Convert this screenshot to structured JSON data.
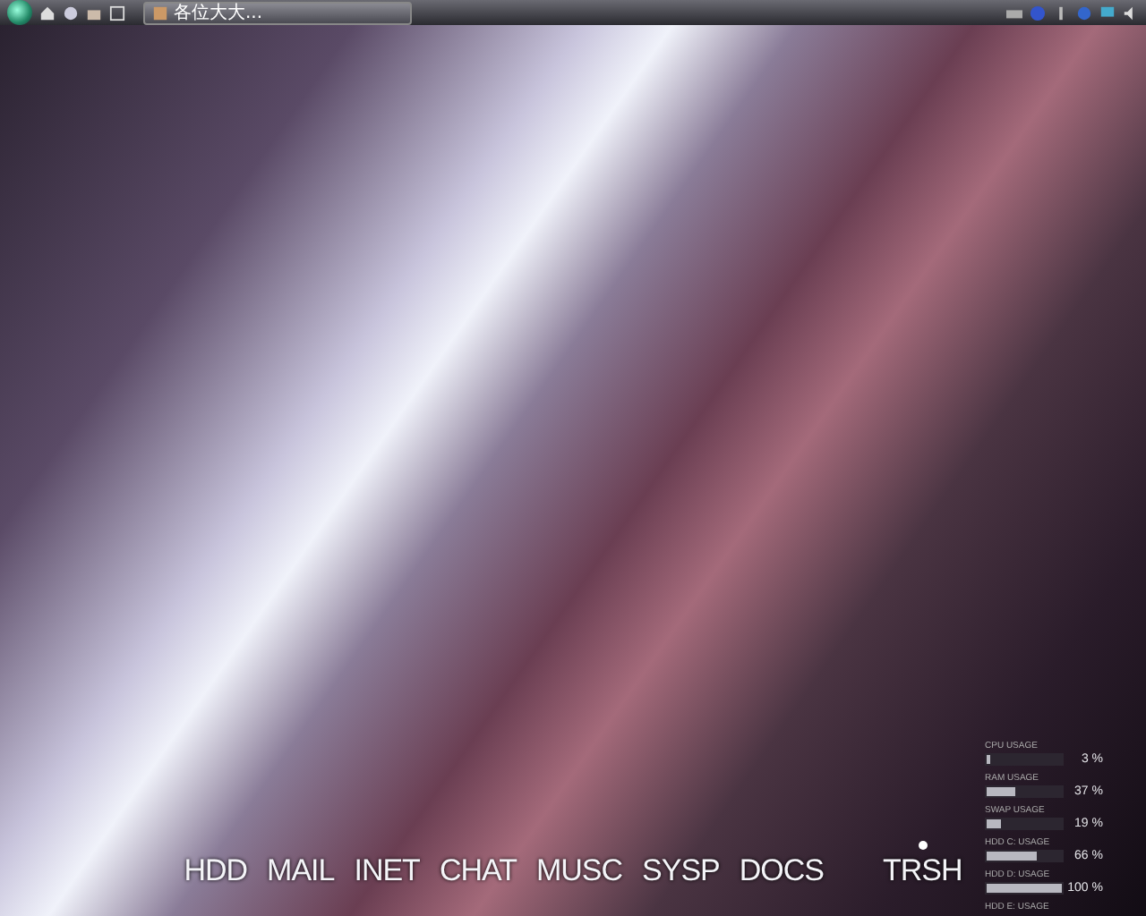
{
  "taskbar": {
    "task_button": {
      "label": "各位大大..."
    }
  },
  "dock": [
    {
      "label": "HDD",
      "active": false
    },
    {
      "label": "MAIL",
      "active": false
    },
    {
      "label": "INET",
      "active": false
    },
    {
      "label": "CHAT",
      "active": false
    },
    {
      "label": "MUSC",
      "active": false
    },
    {
      "label": "SYSP",
      "active": false
    },
    {
      "label": "DOCS",
      "active": false
    },
    {
      "label": "TRSH",
      "active": true
    }
  ],
  "meters": [
    {
      "label": "CPU USAGE",
      "level": 0.03,
      "reading": "3 %"
    },
    {
      "label": "RAM USAGE",
      "level": 0.37,
      "reading": "37 %"
    },
    {
      "label": "SWAP USAGE",
      "level": 0.19,
      "reading": "19 %"
    },
    {
      "label": "HDD C: USAGE",
      "level": 0.66,
      "reading": "66 %"
    },
    {
      "label": "HDD D: USAGE",
      "level": 1,
      "reading": "100 %"
    },
    {
      "label": "HDD E: USAGE"
    }
  ]
}
